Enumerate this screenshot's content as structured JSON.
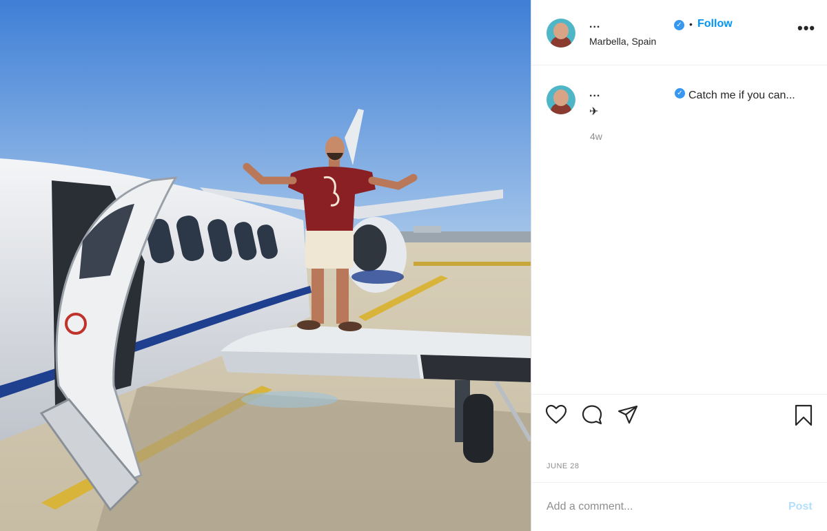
{
  "post": {
    "username": "...",
    "verified": true,
    "follow_label": "Follow",
    "dot": "•",
    "location": "Marbella, Spain",
    "more_icon": "more-horizontal-icon",
    "more_label": "•••"
  },
  "caption": {
    "username": "...",
    "text": "Catch me if you can...✈",
    "time_ago": "4w"
  },
  "actions": {
    "icons": [
      "heart-icon",
      "comment-icon",
      "share-icon",
      "bookmark-icon"
    ]
  },
  "date": "JUNE 28",
  "comment": {
    "placeholder": "Add a comment...",
    "post_label": "Post"
  },
  "colors": {
    "accent": "#0095f6",
    "verified": "#3897f0",
    "post_disabled": "#b2dffc",
    "sky": "#5d8fd4"
  }
}
